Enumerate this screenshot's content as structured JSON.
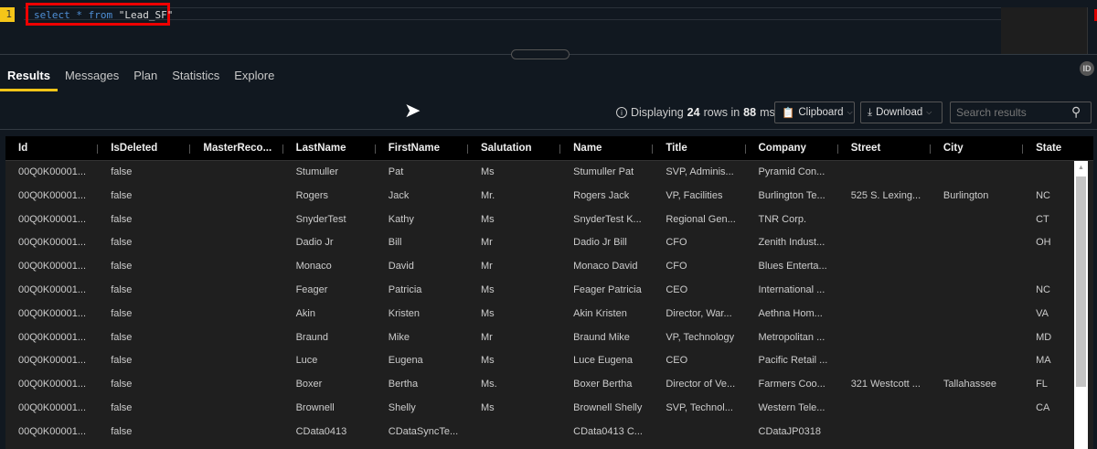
{
  "editor": {
    "line_number": "1",
    "query_keywords": "select * from",
    "query_table": "\"Lead_SF\""
  },
  "tabs": [
    {
      "label": "Results",
      "active": true
    },
    {
      "label": "Messages"
    },
    {
      "label": "Plan"
    },
    {
      "label": "Statistics"
    },
    {
      "label": "Explore"
    }
  ],
  "id_badge": "ID",
  "status": {
    "prefix": "Displaying",
    "rows": "24",
    "middle": "rows in",
    "ms": "88",
    "suffix": "ms"
  },
  "toolbar": {
    "clipboard": "Clipboard",
    "download": "Download",
    "search_placeholder": "Search results"
  },
  "columns": [
    "Id",
    "IsDeleted",
    "MasterReco...",
    "LastName",
    "FirstName",
    "Salutation",
    "Name",
    "Title",
    "Company",
    "Street",
    "City",
    "State"
  ],
  "rows": [
    [
      "00Q0K00001...",
      "false",
      "",
      "Stumuller",
      "Pat",
      "Ms",
      "Stumuller Pat",
      "SVP, Adminis...",
      "Pyramid Con...",
      "",
      "",
      ""
    ],
    [
      "00Q0K00001...",
      "false",
      "",
      "Rogers",
      "Jack",
      "Mr.",
      "Rogers Jack",
      "VP, Facilities",
      "Burlington Te...",
      "525 S. Lexing...",
      "Burlington",
      "NC"
    ],
    [
      "00Q0K00001...",
      "false",
      "",
      "SnyderTest",
      "Kathy",
      "Ms",
      "SnyderTest K...",
      "Regional Gen...",
      "TNR Corp.",
      "",
      "",
      "CT"
    ],
    [
      "00Q0K00001...",
      "false",
      "",
      "Dadio Jr",
      "Bill",
      "Mr",
      "Dadio Jr Bill",
      "CFO",
      "Zenith Indust...",
      "",
      "",
      "OH"
    ],
    [
      "00Q0K00001...",
      "false",
      "",
      "Monaco",
      "David",
      "Mr",
      "Monaco David",
      "CFO",
      "Blues Enterta...",
      "",
      "",
      ""
    ],
    [
      "00Q0K00001...",
      "false",
      "",
      "Feager",
      "Patricia",
      "Ms",
      "Feager Patricia",
      "CEO",
      "International ...",
      "",
      "",
      "NC"
    ],
    [
      "00Q0K00001...",
      "false",
      "",
      "Akin",
      "Kristen",
      "Ms",
      "Akin Kristen",
      "Director, War...",
      "Aethna Hom...",
      "",
      "",
      "VA"
    ],
    [
      "00Q0K00001...",
      "false",
      "",
      "Braund",
      "Mike",
      "Mr",
      "Braund Mike",
      "VP, Technology",
      "Metropolitan ...",
      "",
      "",
      "MD"
    ],
    [
      "00Q0K00001...",
      "false",
      "",
      "Luce",
      "Eugena",
      "Ms",
      "Luce Eugena",
      "CEO",
      "Pacific Retail ...",
      "",
      "",
      "MA"
    ],
    [
      "00Q0K00001...",
      "false",
      "",
      "Boxer",
      "Bertha",
      "Ms.",
      "Boxer Bertha",
      "Director of Ve...",
      "Farmers Coo...",
      "321 Westcott ...",
      "Tallahassee",
      "FL"
    ],
    [
      "00Q0K00001...",
      "false",
      "",
      "Brownell",
      "Shelly",
      "Ms",
      "Brownell Shelly",
      "SVP, Technol...",
      "Western Tele...",
      "",
      "",
      "CA"
    ],
    [
      "00Q0K00001...",
      "false",
      "",
      "CData0413",
      "CDataSyncTe...",
      "",
      "CData0413 C...",
      "",
      "CDataJP0318",
      "",
      "",
      ""
    ]
  ]
}
